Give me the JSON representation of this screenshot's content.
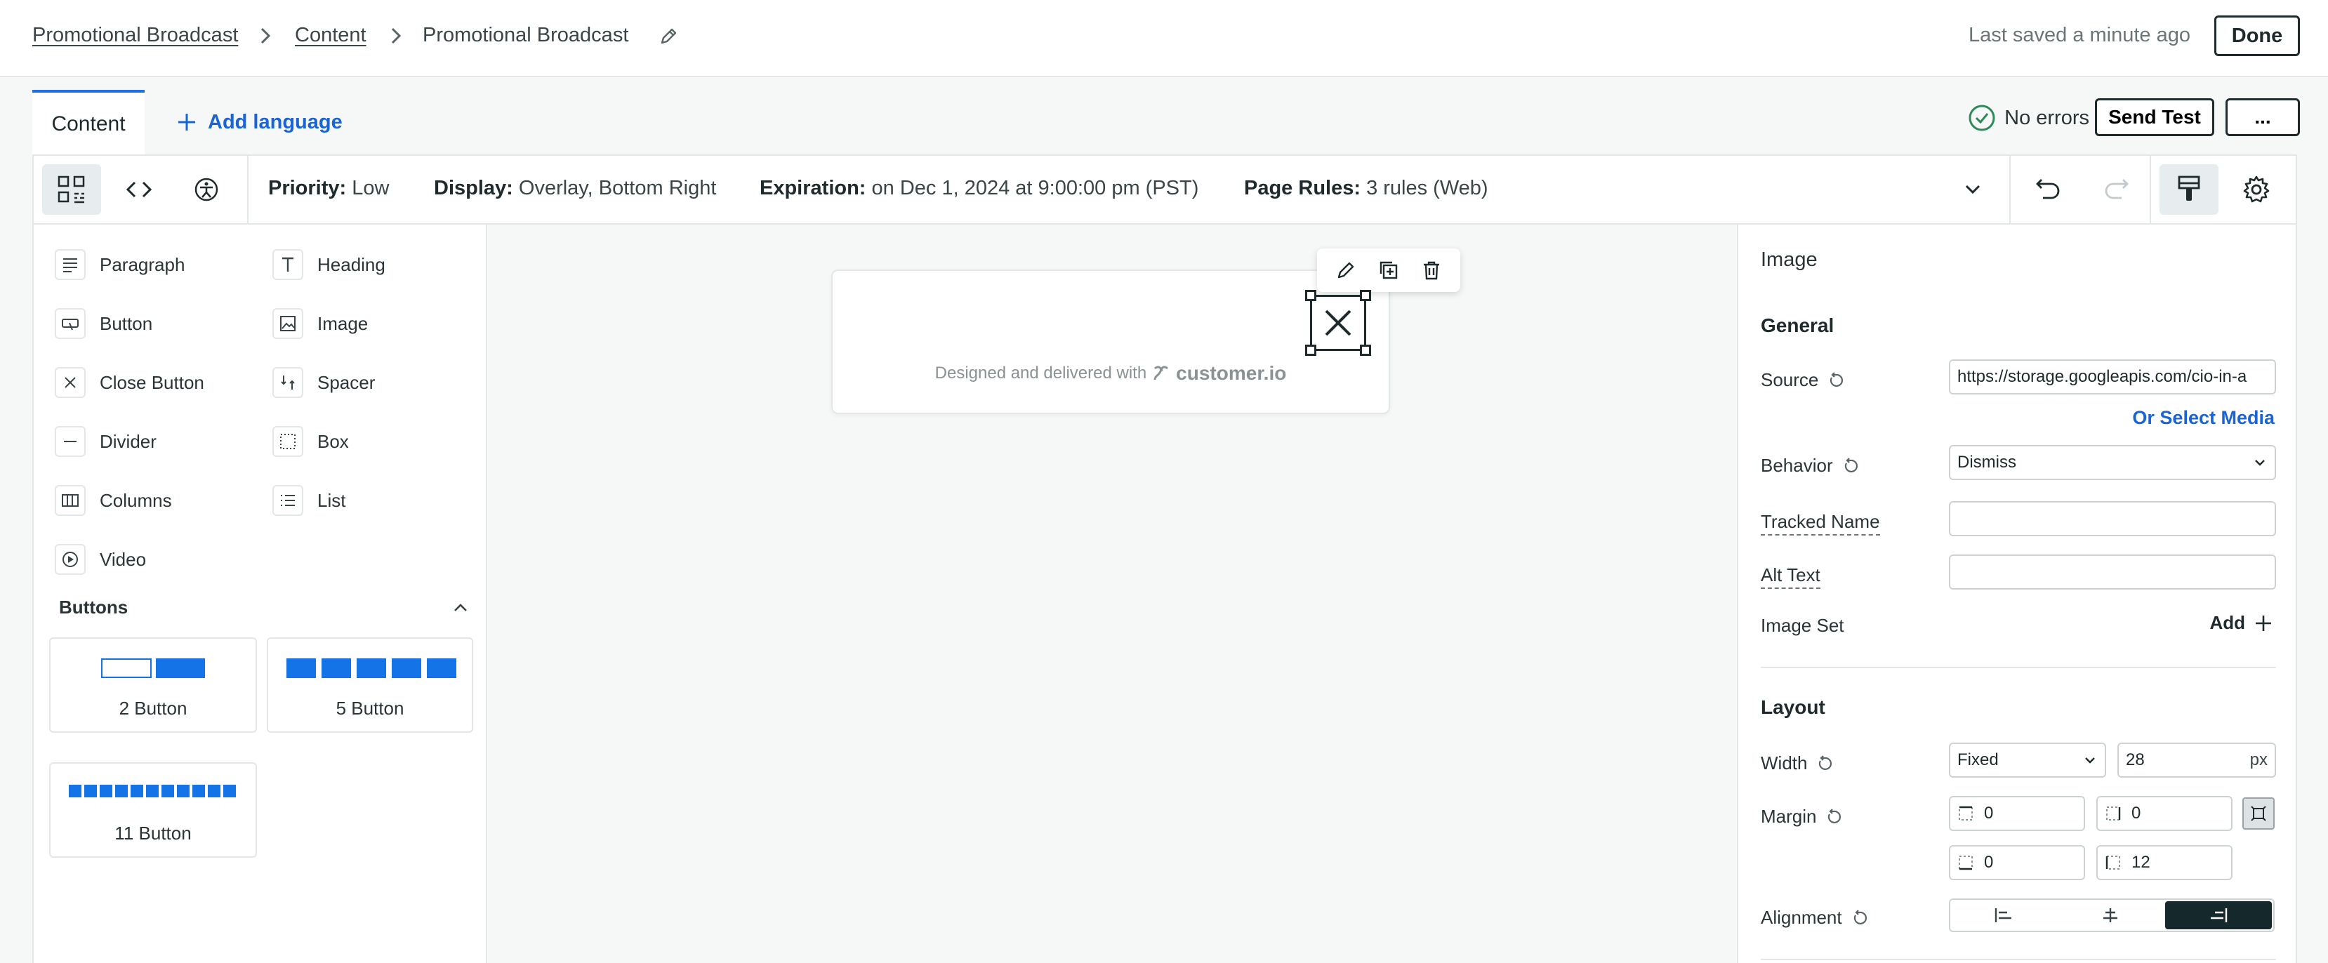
{
  "breadcrumb": {
    "root": "Promotional Broadcast",
    "section": "Content",
    "current": "Promotional Broadcast"
  },
  "header": {
    "last_saved": "Last saved a minute ago",
    "done_label": "Done"
  },
  "tabs": {
    "content": "Content",
    "add_language": "Add language"
  },
  "status": {
    "no_errors": "No errors",
    "send_test": "Send Test",
    "more": "..."
  },
  "toolbar": {
    "priority_label": "Priority:",
    "priority_value": "Low",
    "display_label": "Display:",
    "display_value": "Overlay, Bottom Right",
    "expiration_label": "Expiration:",
    "expiration_value": "on Dec 1, 2024 at 9:00:00 pm (PST)",
    "page_rules_label": "Page Rules:",
    "page_rules_value": "3 rules (Web)"
  },
  "blocks": {
    "paragraph": "Paragraph",
    "heading": "Heading",
    "button": "Button",
    "image": "Image",
    "close_button": "Close Button",
    "spacer": "Spacer",
    "divider": "Divider",
    "box": "Box",
    "columns": "Columns",
    "list": "List",
    "video": "Video"
  },
  "buttons_section": {
    "title": "Buttons",
    "two": "2 Button",
    "five": "5 Button",
    "eleven": "11 Button"
  },
  "canvas": {
    "delivered_text": "Designed and delivered with",
    "brand": "customer.io"
  },
  "panel": {
    "title": "Image",
    "general": "General",
    "source_label": "Source",
    "source_value": "https://storage.googleapis.com/cio-in-a",
    "or_select_media": "Or Select Media",
    "behavior_label": "Behavior",
    "behavior_value": "Dismiss",
    "tracked_name_label": "Tracked Name",
    "tracked_name_value": "",
    "alt_text_label": "Alt Text",
    "alt_text_value": "",
    "image_set_label": "Image Set",
    "image_set_add": "Add",
    "layout": "Layout",
    "width_label": "Width",
    "width_mode": "Fixed",
    "width_value": "28",
    "width_unit": "px",
    "margin_label": "Margin",
    "margin_top": "0",
    "margin_right": "0",
    "margin_bottom": "0",
    "margin_left": "12",
    "alignment_label": "Alignment",
    "alignment_selected": "right"
  },
  "colors": {
    "accent": "#1a64d6",
    "button_blue": "#1473e6",
    "success": "#2e8b57",
    "dark": "#15282b"
  }
}
